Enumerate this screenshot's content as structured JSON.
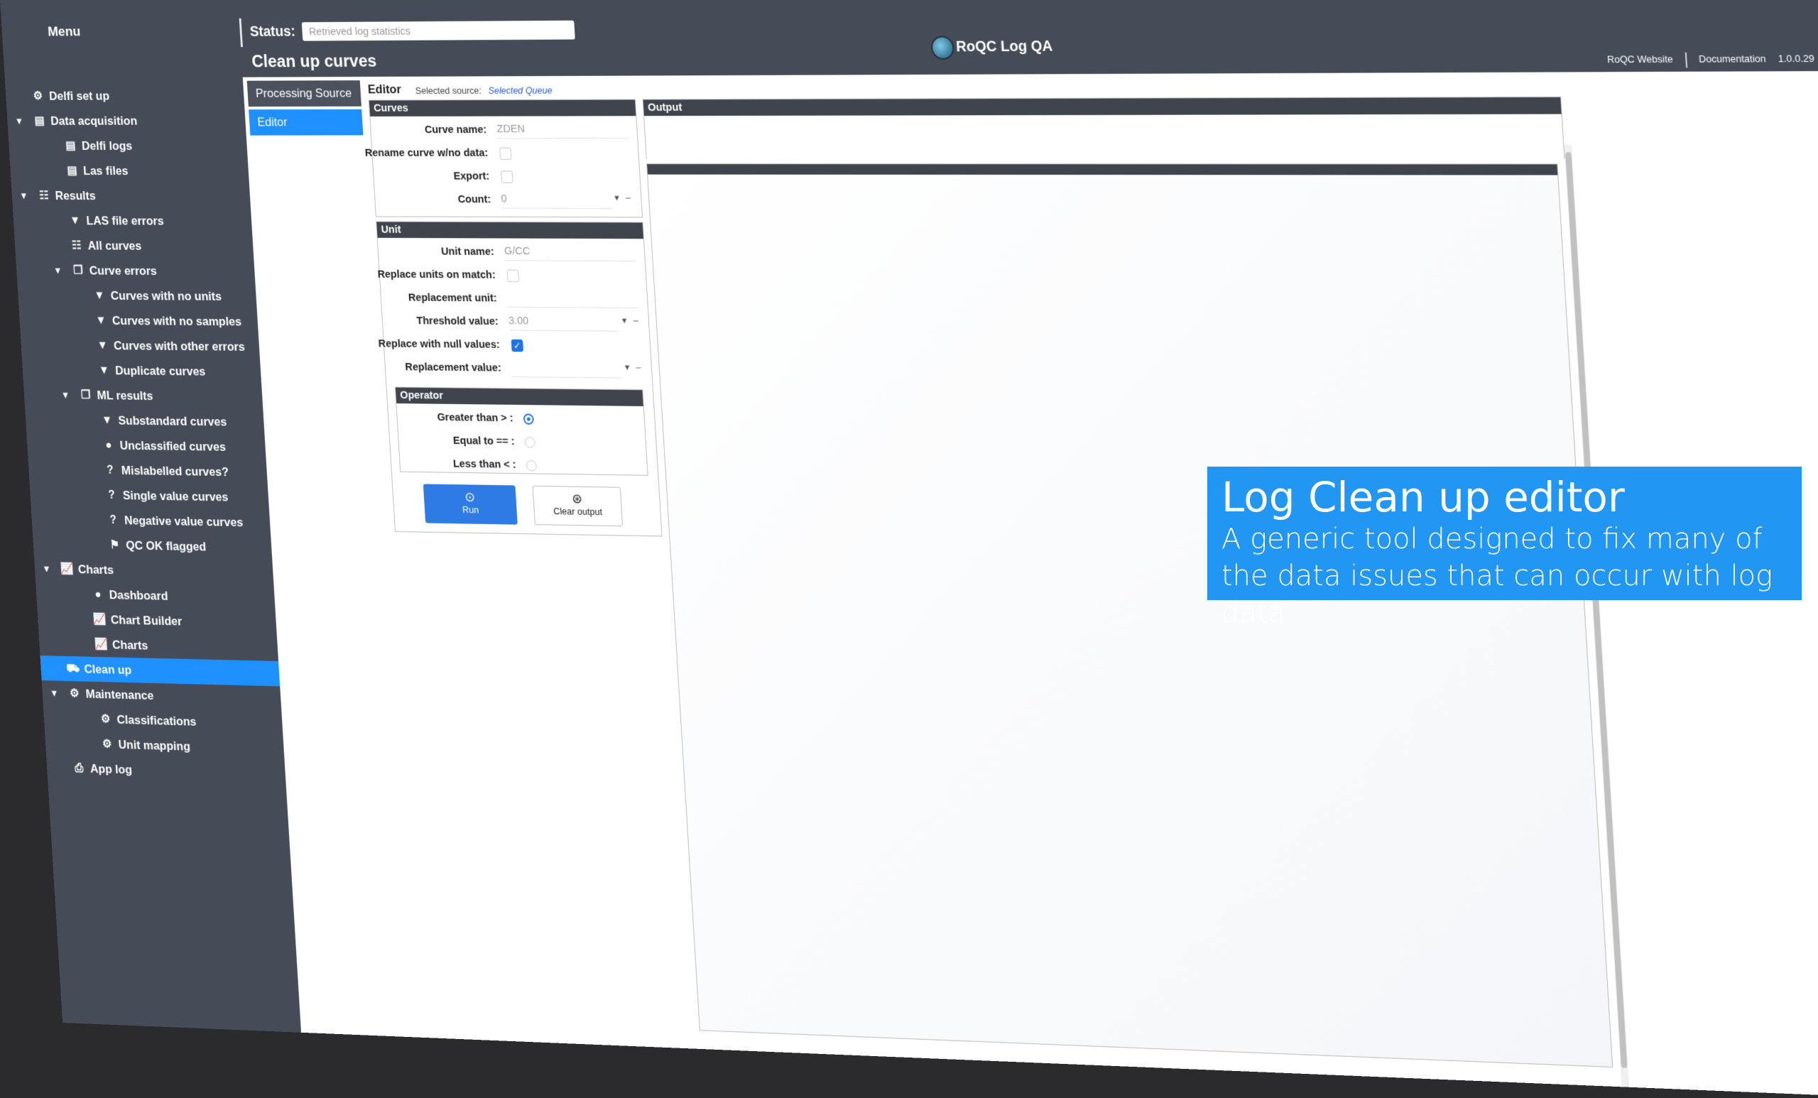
{
  "sidebar": {
    "menu_title": "Menu",
    "items": [
      {
        "label": "Delfi set up",
        "icon": "users-cog-icon",
        "glyph": "⚙",
        "level": 0,
        "arrow": ""
      },
      {
        "label": "Data acquisition",
        "icon": "table-icon",
        "glyph": "▤",
        "level": 0,
        "arrow": "▼"
      },
      {
        "label": "Delfi logs",
        "icon": "table-icon",
        "glyph": "▤",
        "level": 1,
        "arrow": ""
      },
      {
        "label": "Las files",
        "icon": "table-icon",
        "glyph": "▤",
        "level": 1,
        "arrow": ""
      },
      {
        "label": "Results",
        "icon": "list-check-icon",
        "glyph": "☷",
        "level": 0,
        "arrow": "▼"
      },
      {
        "label": "LAS file errors",
        "icon": "comment-icon",
        "glyph": "▼",
        "level": 1,
        "arrow": ""
      },
      {
        "label": "All curves",
        "icon": "list-check-icon",
        "glyph": "☷",
        "level": 1,
        "arrow": ""
      },
      {
        "label": "Curve errors",
        "icon": "copy-icon",
        "glyph": "❐",
        "level": 1,
        "arrow": "▼"
      },
      {
        "label": "Curves with no units",
        "icon": "comment-icon",
        "glyph": "▼",
        "level": 2,
        "arrow": ""
      },
      {
        "label": "Curves with no samples",
        "icon": "comment-icon",
        "glyph": "▼",
        "level": 2,
        "arrow": ""
      },
      {
        "label": "Curves with other errors",
        "icon": "comment-icon",
        "glyph": "▼",
        "level": 2,
        "arrow": ""
      },
      {
        "label": "Duplicate curves",
        "icon": "comment-icon",
        "glyph": "▼",
        "level": 2,
        "arrow": ""
      },
      {
        "label": "ML results",
        "icon": "copy-icon",
        "glyph": "❐",
        "level": 1,
        "arrow": "▼"
      },
      {
        "label": "Substandard curves",
        "icon": "comment-icon",
        "glyph": "▼",
        "level": 2,
        "arrow": ""
      },
      {
        "label": "Unclassified curves",
        "icon": "user-icon",
        "glyph": "●",
        "level": 2,
        "arrow": ""
      },
      {
        "label": "Mislabelled curves?",
        "icon": "question-icon",
        "glyph": "?",
        "level": 2,
        "arrow": ""
      },
      {
        "label": "Single value curves",
        "icon": "question-icon",
        "glyph": "?",
        "level": 2,
        "arrow": ""
      },
      {
        "label": "Negative value curves",
        "icon": "question-icon",
        "glyph": "?",
        "level": 2,
        "arrow": ""
      },
      {
        "label": "QC OK flagged",
        "icon": "flag-icon",
        "glyph": "⚑",
        "level": 2,
        "arrow": ""
      },
      {
        "label": "Charts",
        "icon": "line-chart-icon",
        "glyph": "📈",
        "level": 0,
        "arrow": "▼"
      },
      {
        "label": "Dashboard",
        "icon": "user-tie-icon",
        "glyph": "●",
        "level": 1,
        "arrow": ""
      },
      {
        "label": "Chart Builder",
        "icon": "line-chart-icon",
        "glyph": "📈",
        "level": 1,
        "arrow": ""
      },
      {
        "label": "Charts",
        "icon": "line-chart-icon",
        "glyph": "📈",
        "level": 1,
        "arrow": ""
      },
      {
        "label": "Clean up",
        "icon": "truck-icon",
        "glyph": "⛟",
        "level": 0,
        "arrow": "",
        "active": true
      },
      {
        "label": "Maintenance",
        "icon": "users-cog-icon",
        "glyph": "⚙",
        "level": 0,
        "arrow": "▼"
      },
      {
        "label": "Classifications",
        "icon": "users-cog-icon",
        "glyph": "⚙",
        "level": 1,
        "arrow": ""
      },
      {
        "label": "Unit mapping",
        "icon": "users-cog-icon",
        "glyph": "⚙",
        "level": 1,
        "arrow": ""
      },
      {
        "label": "App log",
        "icon": "print-icon",
        "glyph": "⎙",
        "level": 0,
        "arrow": ""
      }
    ]
  },
  "topbar": {
    "status_label": "Status:",
    "status_value": "Retrieved log statistics",
    "page_title": "Clean up curves",
    "app_title": "RoQC Log QA",
    "links": {
      "website": "RoQC Website",
      "docs": "Documentation",
      "version": "1.0.0.29"
    }
  },
  "tabs": {
    "processing_source": "Processing Source",
    "editor": "Editor"
  },
  "editor": {
    "title": "Editor",
    "selected_source_label": "Selected source:",
    "selected_source_value": "Selected Queue",
    "curves": {
      "header": "Curves",
      "curve_name_label": "Curve name:",
      "curve_name_value": "ZDEN",
      "rename_label": "Rename curve w/no data:",
      "export_label": "Export:",
      "count_label": "Count:",
      "count_value": "0"
    },
    "unit": {
      "header": "Unit",
      "unit_name_label": "Unit name:",
      "unit_name_value": "G/CC",
      "replace_units_label": "Replace units on match:",
      "replacement_unit_label": "Replacement unit:",
      "replacement_unit_value": "",
      "threshold_label": "Threshold value:",
      "threshold_value": "3.00",
      "replace_null_label": "Replace with null values:",
      "replacement_value_label": "Replacement value:",
      "replacement_value_value": ""
    },
    "operator": {
      "header": "Operator",
      "greater_label": "Greater than > :",
      "equal_label": "Equal to == :",
      "less_label": "Less than < :"
    },
    "buttons": {
      "run": "Run",
      "clear": "Clear output"
    },
    "output_header": "Output"
  },
  "caption": {
    "title": "Log Clean up editor",
    "subtitle": "A generic tool designed to fix many of the data issues that can occur with log data"
  },
  "colors": {
    "accent": "#1e90ff",
    "sidebar": "#464c57",
    "caption": "#2196f3"
  }
}
